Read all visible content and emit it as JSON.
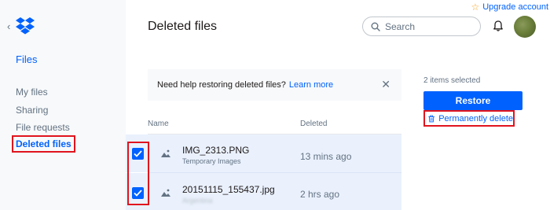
{
  "top": {
    "upgrade_label": "Upgrade account",
    "page_title": "Deleted files",
    "search_placeholder": "Search"
  },
  "sidebar": {
    "section_title": "Files",
    "items": [
      {
        "label": "My files",
        "active": false
      },
      {
        "label": "Sharing",
        "active": false
      },
      {
        "label": "File requests",
        "active": false
      },
      {
        "label": "Deleted files",
        "active": true
      }
    ]
  },
  "banner": {
    "text": "Need help restoring deleted files?",
    "link": "Learn more"
  },
  "table": {
    "columns": [
      "Name",
      "Deleted"
    ],
    "rows": [
      {
        "name": "IMG_2313.PNG",
        "location": "Temporary Images",
        "deleted": "13 mins ago",
        "checked": true
      },
      {
        "name": "20151115_155437.jpg",
        "location": "Argentina",
        "deleted": "2 hrs ago",
        "checked": true
      }
    ]
  },
  "actions": {
    "selected_count": "2 items selected",
    "restore_label": "Restore",
    "permanent_delete_label": "Permanently delete"
  },
  "colors": {
    "accent": "#0061fe",
    "highlight_box": "#e0141e",
    "selected_row": "#eaf1fd"
  }
}
